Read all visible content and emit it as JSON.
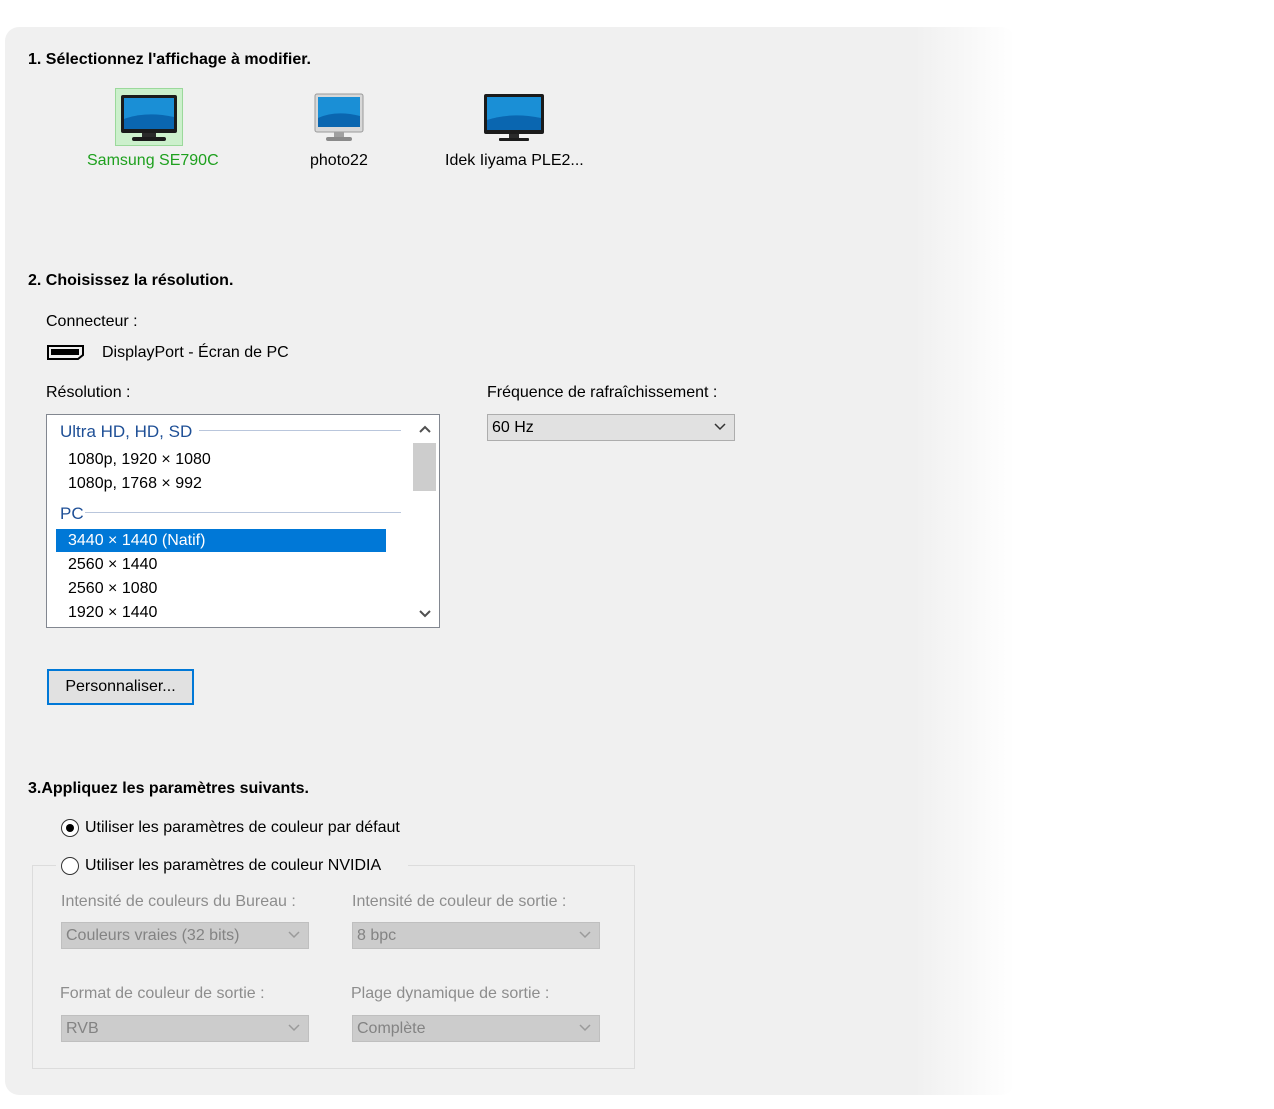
{
  "section1": {
    "heading": "1. Sélectionnez l'affichage à modifier.",
    "monitors": [
      {
        "name": "Samsung SE790C",
        "selected": true
      },
      {
        "name": "photo22",
        "selected": false
      },
      {
        "name": "Idek Iiyama PLE2...",
        "selected": false
      }
    ]
  },
  "section2": {
    "heading": "2. Choisissez la résolution.",
    "connector_label": "Connecteur :",
    "connector_icon": "displayport-icon",
    "connector_value": "DisplayPort - Écran de PC",
    "resolution_label": "Résolution :",
    "resolution_groups": [
      {
        "header": "Ultra HD, HD, SD",
        "items": [
          "1080p, 1920 × 1080",
          "1080p, 1768 × 992"
        ]
      },
      {
        "header": "PC",
        "items": [
          "3440 × 1440 (Natif)",
          "2560 × 1440",
          "2560 × 1080",
          "1920 × 1440"
        ]
      }
    ],
    "selected_resolution": "3440 × 1440 (Natif)",
    "refresh_label": "Fréquence de rafraîchissement :",
    "refresh_value": "60 Hz",
    "customize_button": "Personnaliser..."
  },
  "section3": {
    "heading": "3.Appliquez les paramètres suivants.",
    "radio_default": "Utiliser les paramètres de couleur par défaut",
    "radio_nvidia": "Utiliser les paramètres de couleur NVIDIA",
    "selected_radio": "default",
    "desktop_depth_label": "Intensité de couleurs du Bureau :",
    "desktop_depth_value": "Couleurs vraies (32 bits)",
    "output_depth_label": "Intensité de couleur de sortie :",
    "output_depth_value": "8 bpc",
    "output_format_label": "Format de couleur de sortie :",
    "output_format_value": "RVB",
    "dynamic_range_label": "Plage dynamique de sortie :",
    "dynamic_range_value": "Complète"
  },
  "colors": {
    "selected_monitor_text": "#1ea01e",
    "list_selection": "#0078d7",
    "group_header": "#1e4f96"
  }
}
